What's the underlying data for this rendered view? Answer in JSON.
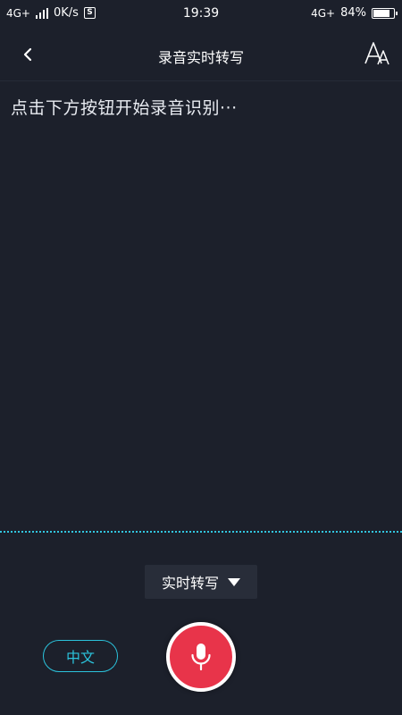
{
  "status_bar": {
    "net_left": "4G+",
    "speed": "0K/s",
    "s_badge": "S",
    "time": "19:39",
    "net_right": "4G+",
    "battery_percent": "84%",
    "battery_level": 0.84
  },
  "nav": {
    "title": "录音实时转写"
  },
  "transcript": {
    "placeholder": "点击下方按钮开始录音识别···"
  },
  "controls": {
    "mode_label": "实时转写",
    "language_label": "中文"
  },
  "colors": {
    "background": "#1c202b",
    "accent": "#2bc3dc",
    "record": "#e8344a"
  },
  "icons": {
    "back": "chevron-left-icon",
    "font_size": "font-size-icon",
    "mode_dropdown": "caret-down-icon",
    "mic": "microphone-icon"
  }
}
